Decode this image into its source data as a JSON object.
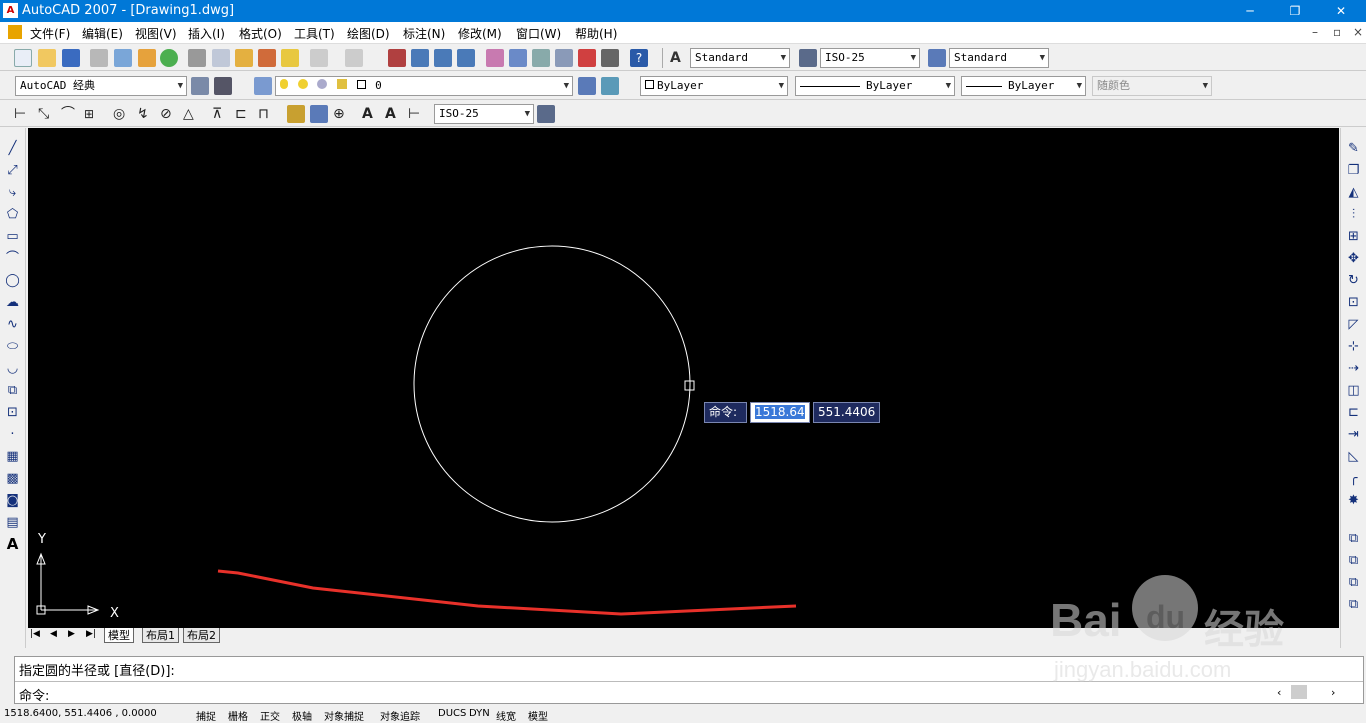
{
  "window": {
    "title": "AutoCAD 2007 - [Drawing1.dwg]",
    "minimize": "─",
    "maximize": "❐",
    "close": "✕",
    "doc_minimize": "–",
    "doc_restore": "▫",
    "doc_close": "×"
  },
  "menu": [
    "文件(F)",
    "编辑(E)",
    "视图(V)",
    "插入(I)",
    "格式(O)",
    "工具(T)",
    "绘图(D)",
    "标注(N)",
    "修改(M)",
    "窗口(W)",
    "帮助(H)"
  ],
  "toolbar": {
    "text_style": "Standard",
    "dim_style": "ISO-25",
    "table_style": "Standard",
    "workspace": "AutoCAD 经典",
    "layer": "0",
    "color": "ByLayer",
    "linetype": "ByLayer",
    "lineweight": "ByLayer",
    "plotstyle": "随颜色",
    "dim_style2": "ISO-25"
  },
  "drawing": {
    "ucs_x": "X",
    "ucs_y": "Y",
    "colors": {
      "background": "#000000",
      "circle": "#ffffff",
      "annotation": "#e8312a"
    }
  },
  "dynamic_input": {
    "label": "命令:",
    "x_value": "1518.64",
    "y_value": "551.4406"
  },
  "layout_tabs": [
    "模型",
    "布局1",
    "布局2"
  ],
  "command": {
    "history": "指定圆的半径或 [直径(D)]:",
    "prompt": "命令:"
  },
  "status": {
    "coords": "1518.6400, 551.4406 , 0.0000",
    "toggles": [
      "捕捉",
      "栅格",
      "正交",
      "极轴",
      "对象捕捉",
      "对象追踪",
      "DUCS",
      "DYN",
      "线宽",
      "模型"
    ]
  },
  "watermark": {
    "brand": "Bai",
    "brand2": "du",
    "suffix": "经验",
    "url": "jingyan.baidu.com"
  }
}
